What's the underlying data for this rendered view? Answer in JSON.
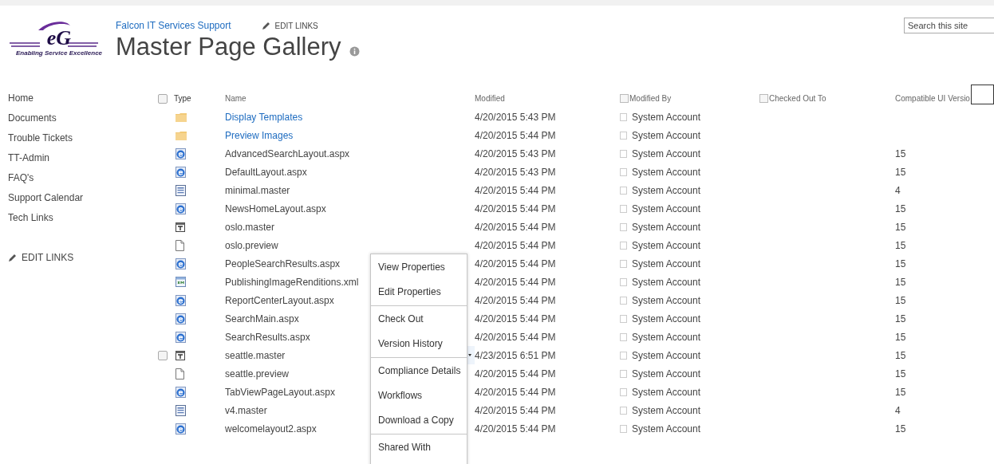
{
  "logo": {
    "mark": "eG",
    "tagline": "Enabling Service Excellence"
  },
  "header": {
    "site_link": "Falcon IT Services Support",
    "edit_links": "EDIT LINKS",
    "title": "Master Page Gallery"
  },
  "search": {
    "placeholder": "Search this site"
  },
  "sidebar": {
    "items": [
      "Home",
      "Documents",
      "Trouble Tickets",
      "TT-Admin",
      "FAQ's",
      "Support Calendar",
      "Tech Links"
    ],
    "edit_links": "EDIT LINKS"
  },
  "table": {
    "select_all": {
      "checked": false
    },
    "columns": [
      {
        "label": "Type"
      },
      {
        "label": "Name"
      },
      {
        "label": "Modified"
      },
      {
        "label": "Modified By",
        "checked": false
      },
      {
        "label": "Checked Out To",
        "checked": false
      },
      {
        "label": "Compatible UI Versio"
      }
    ],
    "rows": [
      {
        "kind": "folder",
        "name": "Display Templates",
        "modified": "4/20/2015 5:43 PM",
        "modified_by": "System Account",
        "hovered": false
      },
      {
        "kind": "folder",
        "name": "Preview Images",
        "modified": "4/20/2015 5:44 PM",
        "modified_by": "System Account",
        "hovered": false
      },
      {
        "kind": "aspx",
        "name": "AdvancedSearchLayout.aspx",
        "modified": "4/20/2015 5:43 PM",
        "modified_by": "System Account",
        "version": "15",
        "hovered": false
      },
      {
        "kind": "aspx",
        "name": "DefaultLayout.aspx",
        "modified": "4/20/2015 5:43 PM",
        "modified_by": "System Account",
        "version": "15",
        "hovered": false
      },
      {
        "kind": "master",
        "name": "minimal.master",
        "modified": "4/20/2015 5:44 PM",
        "modified_by": "System Account",
        "version": "4",
        "hovered": false
      },
      {
        "kind": "aspx",
        "name": "NewsHomeLayout.aspx",
        "modified": "4/20/2015 5:44 PM",
        "modified_by": "System Account",
        "version": "15",
        "hovered": false
      },
      {
        "kind": "template",
        "name": "oslo.master",
        "modified": "4/20/2015 5:44 PM",
        "modified_by": "System Account",
        "version": "15",
        "hovered": false
      },
      {
        "kind": "file",
        "name": "oslo.preview",
        "modified": "4/20/2015 5:44 PM",
        "modified_by": "System Account",
        "version": "15",
        "hovered": false
      },
      {
        "kind": "aspx",
        "name": "PeopleSearchResults.aspx",
        "modified": "4/20/2015 5:44 PM",
        "modified_by": "System Account",
        "version": "15",
        "hovered": false
      },
      {
        "kind": "xml",
        "name": "PublishingImageRenditions.xml",
        "modified": "4/20/2015 5:44 PM",
        "modified_by": "System Account",
        "version": "15",
        "hovered": false
      },
      {
        "kind": "aspx",
        "name": "ReportCenterLayout.aspx",
        "modified": "4/20/2015 5:44 PM",
        "modified_by": "System Account",
        "version": "15",
        "hovered": false
      },
      {
        "kind": "aspx",
        "name": "SearchMain.aspx",
        "modified": "4/20/2015 5:44 PM",
        "modified_by": "System Account",
        "version": "15",
        "hovered": false
      },
      {
        "kind": "aspx",
        "name": "SearchResults.aspx",
        "modified": "4/20/2015 5:44 PM",
        "modified_by": "System Account",
        "version": "15",
        "hovered": false
      },
      {
        "kind": "template",
        "name": "seattle.master",
        "modified": "4/23/2015 6:51 PM",
        "modified_by": "System Account",
        "version": "15",
        "hovered": true
      },
      {
        "kind": "file",
        "name": "seattle.preview",
        "modified": "4/20/2015 5:44 PM",
        "modified_by": "System Account",
        "version": "15",
        "hovered": false
      },
      {
        "kind": "aspx",
        "name": "TabViewPageLayout.aspx",
        "modified": "4/20/2015 5:44 PM",
        "modified_by": "System Account",
        "version": "15",
        "hovered": false
      },
      {
        "kind": "master",
        "name": "v4.master",
        "modified": "4/20/2015 5:44 PM",
        "modified_by": "System Account",
        "version": "4",
        "hovered": false
      },
      {
        "kind": "aspx",
        "name": "welcomelayout2.aspx",
        "modified": "4/20/2015 5:44 PM",
        "modified_by": "System Account",
        "version": "15",
        "hovered": false
      }
    ]
  },
  "context_menu": {
    "groups": [
      [
        "View Properties",
        "Edit Properties"
      ],
      [
        "Check Out",
        "Version History"
      ],
      [
        "Compliance Details",
        "Workflows",
        "Download a Copy"
      ],
      [
        "Shared With"
      ]
    ]
  }
}
